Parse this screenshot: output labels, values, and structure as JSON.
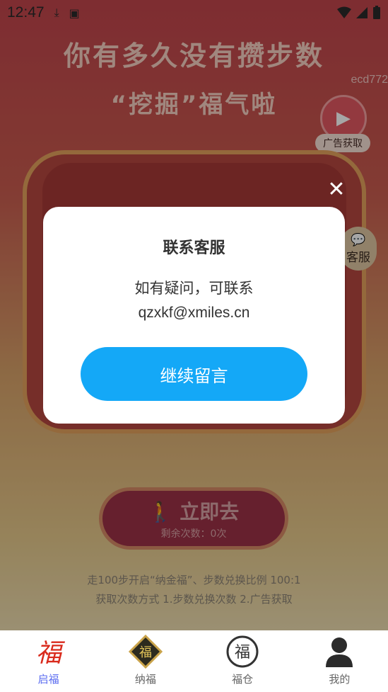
{
  "status_bar": {
    "time": "12:47"
  },
  "background": {
    "headline_1": "你有多久没有攒步数",
    "headline_2": "“挖掘”福气啦",
    "user_id": "ecd772",
    "ad_label": "广告获取",
    "service_label": "客服",
    "go_label": "立即去",
    "go_remaining": "剩余次数：0次",
    "rule_1": "走100步开启“纳金福”、步数兑换比例 100:1",
    "rule_2": "获取次数方式 1.步数兑换次数 2.广告获取"
  },
  "dialog": {
    "title": "联系客服",
    "line_1": "如有疑问，可联系",
    "line_2": "qzxkf@xmiles.cn",
    "button": "继续留言",
    "close_glyph": "✕"
  },
  "bottom_nav": {
    "items": [
      {
        "label": "启福",
        "icon": "fu-calligraphy-icon",
        "active": true
      },
      {
        "label": "纳福",
        "icon": "gold-fu-diamond-icon",
        "active": false
      },
      {
        "label": "福仓",
        "icon": "fu-circle-icon",
        "active": false
      },
      {
        "label": "我的",
        "icon": "person-icon",
        "active": false
      }
    ]
  },
  "colors": {
    "accent_blue": "#14a8f7",
    "nav_active": "#5b6cf0"
  }
}
